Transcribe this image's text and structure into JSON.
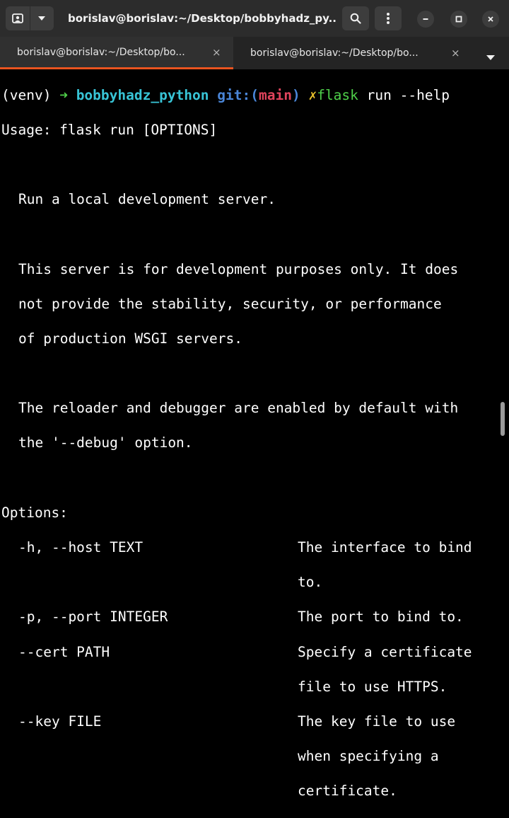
{
  "window": {
    "title": "borislav@borislav:~/Desktop/bobbyhadz_py...",
    "icons": [
      "profile-icon",
      "chevron-down-icon",
      "search-icon",
      "kebab-menu-icon",
      "minimize-icon",
      "maximize-icon",
      "close-icon"
    ]
  },
  "tabs": [
    {
      "label": "borislav@borislav:~/Desktop/bo...",
      "close": "×"
    },
    {
      "label": "borislav@borislav:~/Desktop/bo...",
      "close": "×"
    }
  ],
  "colors": {
    "accent": "#e95420",
    "prompt_arrow": "#4fd04a",
    "prompt_dir": "#38c4d6",
    "git_label": "#4a86d8",
    "git_branch": "#e0445c",
    "dirty_mark": "#e8c12c"
  },
  "terminal": {
    "prompt": {
      "venv": "(venv) ",
      "arrow": "➜",
      "dir": "bobbyhadz_python",
      "git_open": "git:(",
      "branch": "main",
      "git_close": ")",
      "dirty": "✗",
      "cmd_name": "flask",
      "cmd_args": " run --help"
    },
    "usage": "Usage: flask run [OPTIONS]",
    "desc1": "Run a local development server.",
    "desc2": [
      "This server is for development purposes only. It does",
      "not provide the stability, security, or performance",
      "of production WSGI servers."
    ],
    "desc3": [
      "The reloader and debugger are enabled by default with",
      "the '--debug' option."
    ],
    "options_heading": "Options:",
    "options": [
      {
        "name": "-h, --host TEXT",
        "desc": [
          "The interface to bind",
          "to."
        ]
      },
      {
        "name": "-p, --port INTEGER",
        "desc": [
          "The port to bind to."
        ]
      },
      {
        "name": "--cert PATH",
        "desc": [
          "Specify a certificate",
          "file to use HTTPS."
        ]
      },
      {
        "name": "--key FILE",
        "desc": [
          "The key file to use",
          "when specifying a",
          "certificate."
        ]
      }
    ]
  }
}
